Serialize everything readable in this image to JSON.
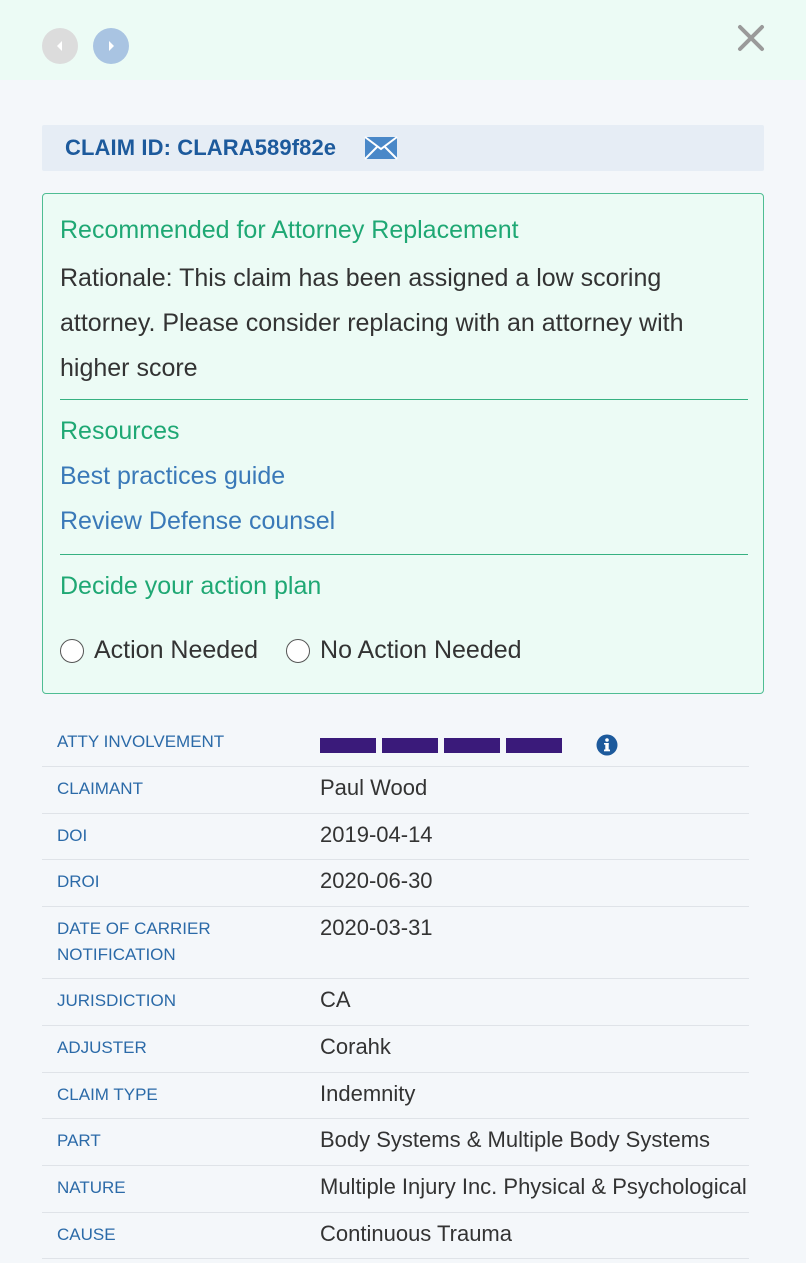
{
  "header": {
    "prev_icon": "chevron-left-icon",
    "next_icon": "chevron-right-icon",
    "close_icon": "close-icon"
  },
  "claim": {
    "id_label": "CLAIM ID: CLARA589f82e",
    "mail_icon": "envelope-icon"
  },
  "recommendation": {
    "title": "Recommended for Attorney Replacement",
    "rationale": "Rationale: This claim has been assigned a low scoring attorney. Please consider replacing with an attorney with higher score",
    "resources_title": "Resources",
    "links": [
      "Best practices guide",
      "Review Defense counsel"
    ],
    "plan_title": "Decide your action plan",
    "options": [
      "Action Needed",
      "No Action Needed"
    ]
  },
  "details": {
    "atty_label": "ATTY INVOLVEMENT",
    "atty_level": {
      "filled": 4,
      "total": 4
    },
    "rows": [
      {
        "label": "CLAIMANT",
        "value": "Paul Wood"
      },
      {
        "label": "DOI",
        "value": "2019-04-14"
      },
      {
        "label": "DROI",
        "value": "2020-06-30"
      },
      {
        "label": "DATE OF CARRIER NOTIFICATION",
        "value": "2020-03-31"
      },
      {
        "label": "JURISDICTION",
        "value": "CA"
      },
      {
        "label": "ADJUSTER",
        "value": "Corahk"
      },
      {
        "label": "CLAIM TYPE",
        "value": "Indemnity"
      },
      {
        "label": "PART",
        "value": "Body Systems & Multiple Body Systems"
      },
      {
        "label": "NATURE",
        "value": "Multiple Injury Inc. Physical & Psychological"
      },
      {
        "label": "CAUSE",
        "value": "Continuous Trauma"
      }
    ]
  },
  "colors": {
    "accent_green": "#1fa874",
    "link_blue": "#3a79b8",
    "label_blue": "#2b6aa8",
    "bar_purple": "#3a1a7a"
  }
}
